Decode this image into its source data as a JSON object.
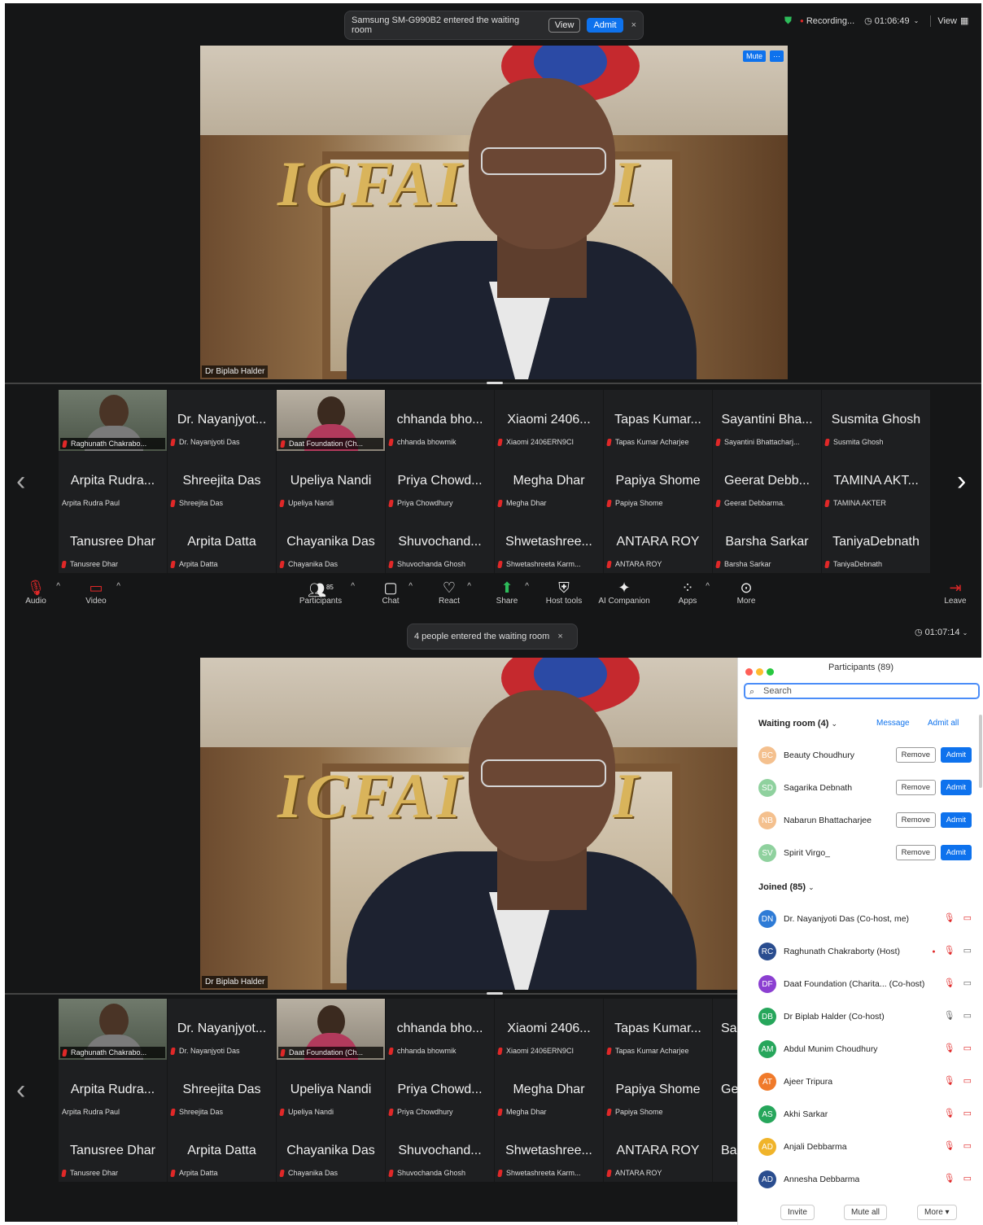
{
  "top": {
    "notification": {
      "text": "Samsung SM-G990B2 entered the waiting room",
      "view_label": "View",
      "admit_label": "Admit",
      "close": "×"
    },
    "status": {
      "recording": "Recording...",
      "timer": "01:06:49",
      "view_label": "View"
    },
    "speaker_name": "Dr Biplab Halder",
    "video_buttons": {
      "mute": "Mute",
      "more": "···"
    },
    "video_sign": "ICFAI   ERSI"
  },
  "gallery": {
    "row1": [
      {
        "name": "",
        "sub": "Raghunath Chakrabo...",
        "photo": true
      },
      {
        "name": "Dr. Nayanjyot...",
        "sub": "Dr. Nayanjyoti Das"
      },
      {
        "name": "",
        "sub": "Daat Foundation (Ch...",
        "photo": true
      },
      {
        "name": "chhanda bho...",
        "sub": "chhanda bhowmik"
      },
      {
        "name": "Xiaomi 2406...",
        "sub": "Xiaomi 2406ERN9CI"
      },
      {
        "name": "Tapas Kumar...",
        "sub": "Tapas Kumar Acharjee"
      },
      {
        "name": "Sayantini Bha...",
        "sub": "Sayantini Bhattacharj..."
      },
      {
        "name": "Susmita Ghosh",
        "sub": "Susmita Ghosh"
      }
    ],
    "row2": [
      {
        "name": "Arpita Rudra...",
        "sub": "Arpita Rudra Paul"
      },
      {
        "name": "Shreejita Das",
        "sub": "Shreejita Das"
      },
      {
        "name": "Upeliya Nandi",
        "sub": "Upeliya Nandi"
      },
      {
        "name": "Priya Chowd...",
        "sub": "Priya Chowdhury"
      },
      {
        "name": "Megha Dhar",
        "sub": "Megha Dhar"
      },
      {
        "name": "Papiya Shome",
        "sub": "Papiya Shome"
      },
      {
        "name": "Geerat Debb...",
        "sub": "Geerat Debbarma."
      },
      {
        "name": "TAMINA AKT...",
        "sub": "TAMINA AKTER"
      }
    ],
    "row3": [
      {
        "name": "Tanusree Dhar",
        "sub": "Tanusree Dhar"
      },
      {
        "name": "Arpita Datta",
        "sub": "Arpita Datta"
      },
      {
        "name": "Chayanika Das",
        "sub": "Chayanika Das"
      },
      {
        "name": "Shuvochand...",
        "sub": "Shuvochanda Ghosh"
      },
      {
        "name": "Shwetashree...",
        "sub": "Shwetashreeta Karm..."
      },
      {
        "name": "ANTARA ROY",
        "sub": "ANTARA ROY"
      },
      {
        "name": "Barsha Sarkar",
        "sub": "Barsha Sarkar"
      },
      {
        "name": "TaniyaDebnath",
        "sub": "TaniyaDebnath"
      }
    ],
    "row1_bottom_partial": "Sa",
    "row2_bottom_partial": "Ge",
    "row3_bottom_partial": "Ba"
  },
  "toolbar": {
    "audio": "Audio",
    "video": "Video",
    "participants": "Participants",
    "participants_count": "85",
    "chat": "Chat",
    "react": "React",
    "share": "Share",
    "host_tools": "Host tools",
    "ai_companion": "AI Companion",
    "apps": "Apps",
    "more": "More",
    "leave": "Leave"
  },
  "bottom": {
    "notification": {
      "text": "4 people entered the waiting room",
      "close": "×"
    },
    "timer": "01:07:14",
    "speaker_name": "Dr Biplab Halder"
  },
  "participants_panel": {
    "title": "Participants (89)",
    "search_placeholder": "Search",
    "waiting_label": "Waiting room (4)",
    "message_label": "Message",
    "admit_all_label": "Admit all",
    "remove_label": "Remove",
    "admit_label": "Admit",
    "waiting": [
      {
        "initials": "BC",
        "name": "Beauty Choudhury",
        "color": "#f4c08e"
      },
      {
        "initials": "SD",
        "name": "Sagarika Debnath",
        "color": "#8fd19e"
      },
      {
        "initials": "NB",
        "name": "Nabarun Bhattacharjee",
        "color": "#f4c08e"
      },
      {
        "initials": "SV",
        "name": "Spirit Virgo_",
        "color": "#8fd19e"
      }
    ],
    "joined_label": "Joined (85)",
    "joined": [
      {
        "initials": "DN",
        "name": "Dr. Nayanjyoti Das (Co-host, me)",
        "color": "#2e7bd6"
      },
      {
        "initials": "RC",
        "name": "Raghunath Chakraborty (Host)",
        "color": "#2a4d8f"
      },
      {
        "initials": "DF",
        "name": "Daat Foundation (Charita... (Co-host)",
        "color": "#8b3fd1"
      },
      {
        "initials": "DB",
        "name": "Dr Biplab Halder (Co-host)",
        "color": "#26a65b"
      },
      {
        "initials": "AM",
        "name": "Abdul Munim Choudhury",
        "color": "#26a65b"
      },
      {
        "initials": "AT",
        "name": "Ajeer Tripura",
        "color": "#f07a2a"
      },
      {
        "initials": "AS",
        "name": "Akhi Sarkar",
        "color": "#26a65b"
      },
      {
        "initials": "AD",
        "name": "Anjali Debbarma",
        "color": "#f0b42a"
      },
      {
        "initials": "AD",
        "name": "Annesha Debbarma",
        "color": "#2a4d8f"
      }
    ],
    "footer": {
      "invite": "Invite",
      "mute_all": "Mute all",
      "more": "More ▾"
    }
  }
}
